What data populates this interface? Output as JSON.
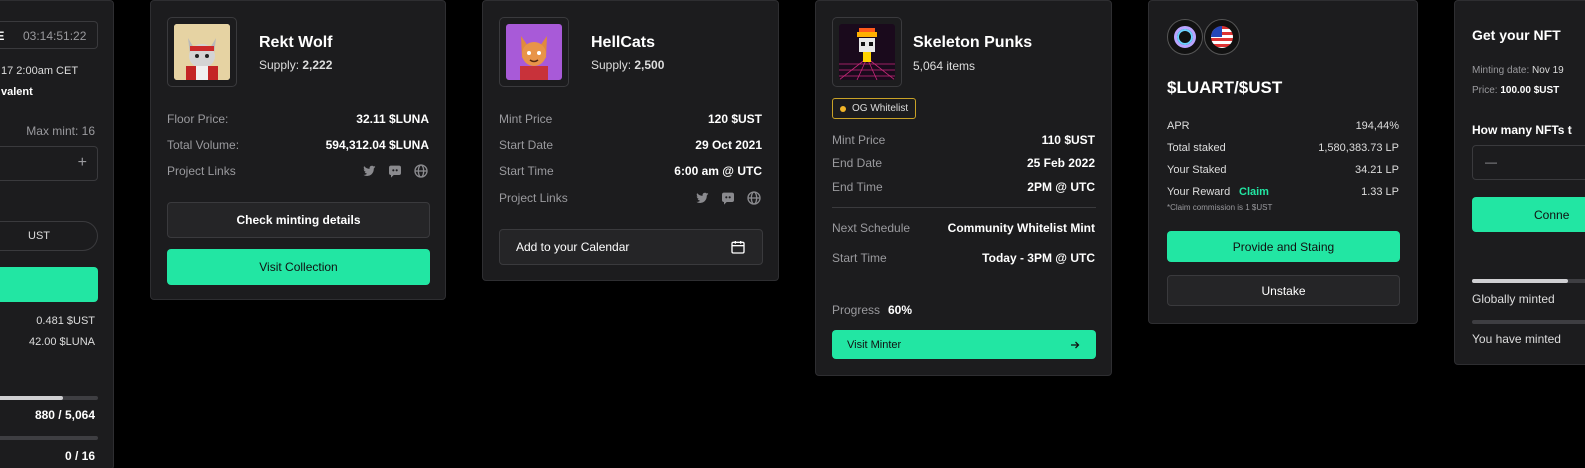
{
  "card0": {
    "timer_prefix": "/E",
    "timer": "03:14:51:22",
    "date_line": "17 2:00am CET",
    "equivalent": "valent",
    "max_mint": "Max mint: 16",
    "plus": "+",
    "currency": "UST",
    "price_ust": "0.481 $UST",
    "price_luna": "42.00 $LUNA",
    "minted_global": "880 / 5,064",
    "minted_mine": "0 / 16"
  },
  "card1": {
    "name": "Rekt Wolf",
    "supply_label": "Supply:",
    "supply": "2,222",
    "rows": [
      {
        "label": "Floor Price:",
        "value": "32.11 $LUNA"
      },
      {
        "label": "Total Volume:",
        "value": "594,312.04 $LUNA"
      }
    ],
    "links_label": "Project Links",
    "btn_details": "Check minting details",
    "btn_visit": "Visit Collection"
  },
  "card2": {
    "name": "HellCats",
    "supply_label": "Supply:",
    "supply": "2,500",
    "rows": [
      {
        "label": "Mint Price",
        "value": "120 $UST"
      },
      {
        "label": "Start Date",
        "value": "29 Oct 2021"
      },
      {
        "label": "Start Time",
        "value": "6:00 am @ UTC"
      }
    ],
    "links_label": "Project Links",
    "btn_calendar": "Add to your Calendar"
  },
  "card3": {
    "name": "Skeleton Punks",
    "items": "5,064 items",
    "badge": "OG Whitelist",
    "rows": [
      {
        "label": "Mint Price",
        "value": "110 $UST"
      },
      {
        "label": "End Date",
        "value": "25 Feb 2022"
      },
      {
        "label": "End Time",
        "value": "2PM @ UTC"
      }
    ],
    "rows2": [
      {
        "label": "Next Schedule",
        "value": "Community Whitelist Mint"
      },
      {
        "label": "Start Time",
        "value": "Today - 3PM @ UTC"
      }
    ],
    "progress_label": "Progress",
    "progress_value": "60%",
    "btn_minter": "Visit Minter"
  },
  "card4": {
    "pair": "$LUART/$UST",
    "rows": [
      {
        "label": "APR",
        "value": "194,44%"
      },
      {
        "label": "Total staked",
        "value": "1,580,383.73 LP"
      },
      {
        "label": "Your Staked",
        "value": "34.21 LP"
      }
    ],
    "reward_label": "Your Reward",
    "claim": "Claim",
    "reward_value": "1.33 LP",
    "note": "*Claim commission is 1 $UST",
    "btn_provide": "Provide and Staing",
    "btn_unstake": "Unstake"
  },
  "card5": {
    "title": "Get your NFT",
    "minting_date_label": "Minting date:",
    "minting_date": "Nov 19",
    "price_label": "Price:",
    "price": "100.00 $UST",
    "question": "How many NFTs t",
    "minus": "—",
    "btn_connect": "Conne",
    "global_label": "Globally minted",
    "mine_label": "You have minted"
  },
  "progress": {
    "card0_global": 0.7,
    "card0_mine": 0.0,
    "card5_global": 0.6,
    "card5_mine": 0.0
  },
  "colors": {
    "accent": "#22e6a3",
    "card_bg": "#1c1c1e",
    "badge_border": "#c9a227"
  }
}
